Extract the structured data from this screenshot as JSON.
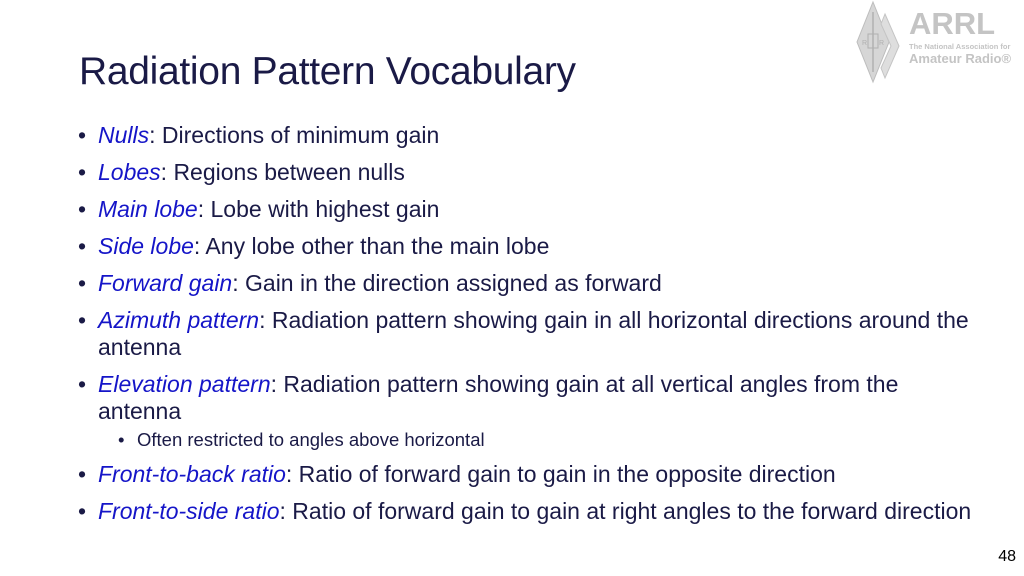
{
  "slide": {
    "title": "Radiation Pattern Vocabulary",
    "page_number": "48",
    "colors": {
      "title": "#1a1a46",
      "term": "#1515c8",
      "logo": "#c4c4c4"
    }
  },
  "logo": {
    "name": "ARRL",
    "tagline": "The National Association for",
    "subtitle": "Amateur Radio®",
    "icon": "arrl-diamond-logo-icon"
  },
  "bullets": [
    {
      "term": "Nulls",
      "definition": ": Directions of minimum gain"
    },
    {
      "term": "Lobes",
      "definition": ": Regions between nulls"
    },
    {
      "term": "Main lobe",
      "definition": ": Lobe with highest gain"
    },
    {
      "term": "Side lobe",
      "definition": ": Any lobe other than the main lobe"
    },
    {
      "term": "Forward gain",
      "definition": ": Gain in the direction assigned as forward"
    },
    {
      "term": "Azimuth pattern",
      "definition": ": Radiation pattern showing gain in all horizontal directions around the antenna"
    },
    {
      "term": "Elevation pattern",
      "definition": ": Radiation pattern showing gain at all vertical angles from the antenna",
      "sub": [
        "Often restricted to angles above horizontal"
      ]
    },
    {
      "term": "Front-to-back ratio",
      "definition": ": Ratio of forward gain to gain in the opposite direction"
    },
    {
      "term": "Front-to-side ratio",
      "definition": ": Ratio of forward gain to gain at right angles to the forward direction"
    }
  ]
}
